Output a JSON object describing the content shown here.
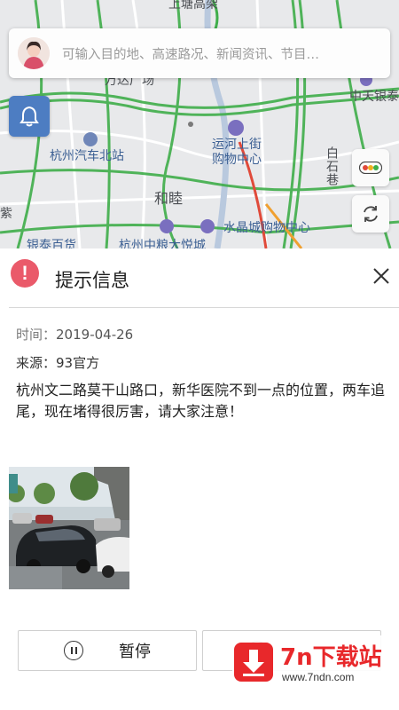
{
  "map": {
    "labels": {
      "top_road": "上塘高架",
      "partial_left": "万达广场",
      "bank": "中天银泰",
      "bus_station": "杭州汽车北站",
      "mall": "运河上街购物中心",
      "district": "和睦",
      "baishixiang": "白石巷",
      "crystal_mall": "水晶城购物中心",
      "left_partial": "半山紫",
      "bottom_left": "银泰百货",
      "bottom_mid": "杭州中粮大悦城"
    }
  },
  "search": {
    "placeholder": "可输入目的地、高速路况、新闻资讯、节目…"
  },
  "icons": {
    "bell": "bell-icon",
    "traffic": "traffic-light-icon",
    "refresh": "refresh-icon",
    "alert": "alert-icon",
    "close": "close-icon",
    "pause": "pause-icon"
  },
  "info": {
    "title": "提示信息",
    "time_label": "时间：",
    "time_value": "2019-04-26",
    "source_label": "来源：",
    "source_value": "93官方",
    "content": "杭州文二路莫干山路口，新华医院不到一点的位置，两车追尾，现在堵得很厉害，请大家注意！"
  },
  "actions": {
    "pause_label": "暂停"
  },
  "watermark": {
    "text": "7n下载站",
    "url": "www.7ndn.com"
  },
  "colors": {
    "alert": "#ea5a6a",
    "bell_button": "#4d7dc2",
    "road_green": "#3fae4a",
    "watermark_red": "#e8282b"
  }
}
